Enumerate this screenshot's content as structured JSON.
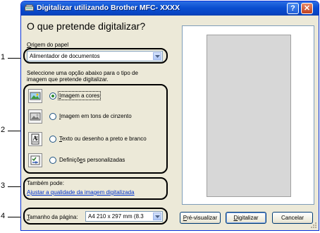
{
  "window": {
    "title": "Digitalizar utilizando Brother MFC- XXXX",
    "help_label": "?",
    "close_label": "✕"
  },
  "heading": "O que pretende digitalizar?",
  "paper_source": {
    "label_prefix": "O",
    "label_rest": "rigem do papel",
    "value": "Alimentador de documentos"
  },
  "instruction_line1": "Seleccione uma opção abaixo para o tipo de",
  "instruction_line2": "imagem que pretende digitalizar.",
  "options": [
    {
      "pre": "",
      "key": "I",
      "post": "magem a cores",
      "icon": "color-image-icon",
      "selected": true
    },
    {
      "pre": "",
      "key": "I",
      "post": "magem em tons de cinzento",
      "icon": "grayscale-image-icon",
      "selected": false
    },
    {
      "pre": "",
      "key": "T",
      "post": "exto ou desenho a preto e branco",
      "icon": "text-document-icon",
      "selected": false
    },
    {
      "pre": "Definiçõ",
      "key": "e",
      "post": "s personalizadas",
      "icon": "custom-settings-icon",
      "selected": false
    }
  ],
  "also": {
    "label": "Também pode:",
    "link": "Ajustar a qualidade da imagem digitalizada"
  },
  "page_size": {
    "label_prefix": "T",
    "label_rest": "amanho da página:",
    "value": "A4 210 x 297 mm (8.3"
  },
  "buttons": {
    "preview_key": "P",
    "preview_rest": "ré-visualizar",
    "scan_key": "D",
    "scan_rest": "igitalizar",
    "cancel": "Cancelar"
  },
  "callouts": [
    "1",
    "2",
    "3",
    "4"
  ]
}
